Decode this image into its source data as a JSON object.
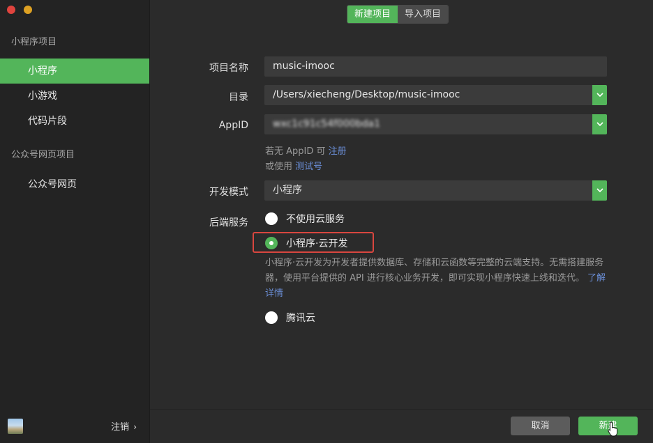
{
  "sidebar": {
    "section_mini": "小程序项目",
    "items_mini": [
      {
        "label": "小程序"
      },
      {
        "label": "小游戏"
      },
      {
        "label": "代码片段"
      }
    ],
    "section_official": "公众号网页项目",
    "items_official": [
      {
        "label": "公众号网页"
      }
    ],
    "logout_label": "注销",
    "logout_chevron": "›"
  },
  "tabs": [
    {
      "label": "新建项目"
    },
    {
      "label": "导入项目"
    }
  ],
  "form": {
    "name_label": "项目名称",
    "name_value": "music-imooc",
    "dir_label": "目录",
    "dir_value": "/Users/xiecheng/Desktop/music-imooc",
    "appid_label": "AppID",
    "appid_value": "wxc1c91c54f000bda1",
    "hint_line1_prefix": "若无 AppID 可",
    "hint_line1_link": "注册",
    "hint_line2_prefix": "或使用",
    "hint_line2_link": "测试号",
    "mode_label": "开发模式",
    "mode_value": "小程序",
    "backend_label": "后端服务",
    "options": [
      {
        "label": "不使用云服务",
        "checked": false
      },
      {
        "label": "小程序·云开发",
        "checked": true
      },
      {
        "label": "腾讯云",
        "checked": false
      }
    ],
    "cloud_desc": "小程序·云开发为开发者提供数据库、存储和云函数等完整的云端支持。无需搭建服务器，使用平台提供的 API 进行核心业务开发，即可实现小程序快速上线和迭代。",
    "cloud_desc_link": "了解详情"
  },
  "buttons": {
    "cancel": "取消",
    "create": "新建"
  },
  "colors": {
    "accent": "#53b55a",
    "highlight": "#d9463f",
    "link": "#6b8fd8"
  }
}
